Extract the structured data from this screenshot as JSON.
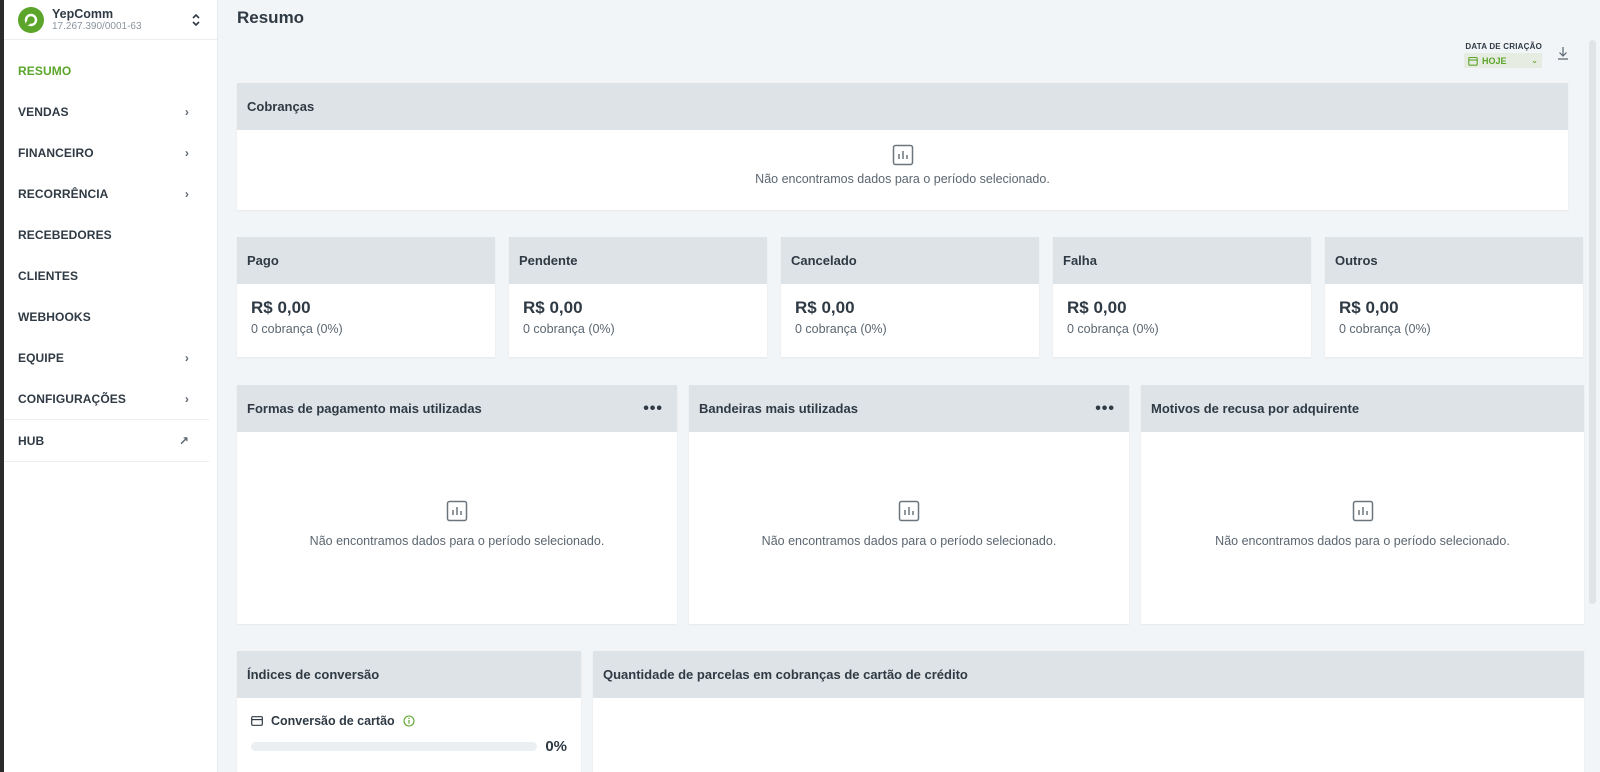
{
  "company": {
    "name": "YepComm",
    "document": "17.267.390/0001-63"
  },
  "nav": [
    {
      "label": "RESUMO",
      "chevron": ""
    },
    {
      "label": "VENDAS",
      "chevron": "›"
    },
    {
      "label": "FINANCEIRO",
      "chevron": "›"
    },
    {
      "label": "RECORRÊNCIA",
      "chevron": "›"
    },
    {
      "label": "RECEBEDORES",
      "chevron": ""
    },
    {
      "label": "CLIENTES",
      "chevron": ""
    },
    {
      "label": "WEBHOOKS",
      "chevron": ""
    },
    {
      "label": "EQUIPE",
      "chevron": "›"
    },
    {
      "label": "CONFIGURAÇÕES",
      "chevron": "›"
    },
    {
      "label": "HUB",
      "chevron": "↗"
    }
  ],
  "header": {
    "title": "Resumo",
    "date_filter_label": "DATA DE CRIAÇÃO",
    "date_filter_value": "HOJE"
  },
  "empty_message": "Não encontramos dados para o período selecionado.",
  "cobrancas": {
    "title": "Cobranças"
  },
  "stats": [
    {
      "title": "Pago",
      "value": "R$ 0,00",
      "sub": "0 cobrança (0%)"
    },
    {
      "title": "Pendente",
      "value": "R$ 0,00",
      "sub": "0 cobrança (0%)"
    },
    {
      "title": "Cancelado",
      "value": "R$ 0,00",
      "sub": "0 cobrança (0%)"
    },
    {
      "title": "Falha",
      "value": "R$ 0,00",
      "sub": "0 cobrança (0%)"
    },
    {
      "title": "Outros",
      "value": "R$ 0,00",
      "sub": "0 cobrança (0%)"
    }
  ],
  "panels": [
    {
      "title": "Formas de pagamento mais utilizadas",
      "menu": "•••"
    },
    {
      "title": "Bandeiras mais utilizadas",
      "menu": "•••"
    },
    {
      "title": "Motivos de recusa por adquirente",
      "menu": ""
    }
  ],
  "conversion": {
    "title": "Índices de conversão",
    "card_label": "Conversão de cartão",
    "percent_label": "0%",
    "progress": 0
  },
  "installments": {
    "title": "Quantidade de parcelas em cobranças de cartão de crédito"
  },
  "colors": {
    "accent": "#5aa52a",
    "card_header": "#dde3e7",
    "background": "#f2f5f7"
  }
}
